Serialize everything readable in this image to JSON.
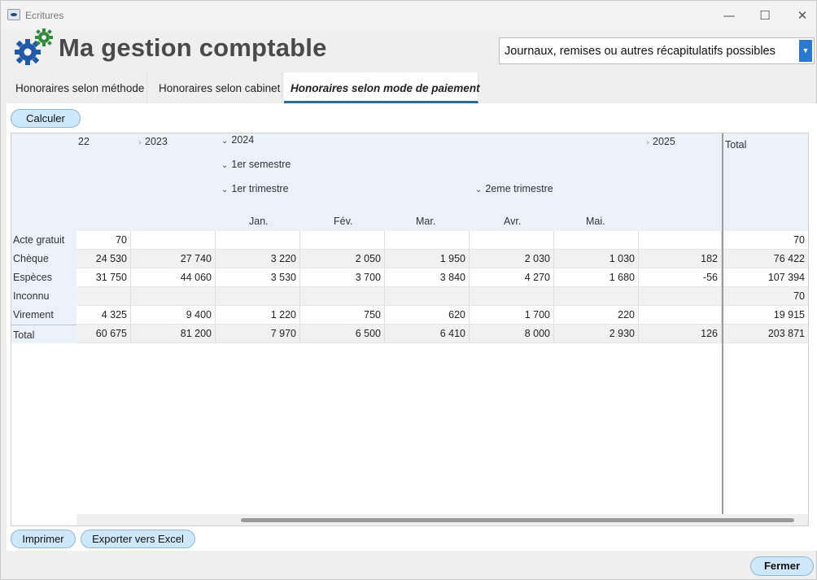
{
  "window": {
    "title": "Ecritures",
    "minimize_glyph": "—",
    "maximize_glyph": "☐",
    "close_glyph": "✕"
  },
  "header": {
    "app_title": "Ma gestion comptable"
  },
  "report_select": {
    "value": "Journaux, remises ou autres récapitulatifs possibles",
    "arrow": "▼"
  },
  "tabs": [
    {
      "label": "Honoraires selon méthode"
    },
    {
      "label": "Honoraires selon cabinet"
    },
    {
      "label": "Honoraires selon mode de paiement",
      "active": true
    }
  ],
  "toolbar": {
    "calculate_label": "Calculer"
  },
  "grid": {
    "years": [
      {
        "label": "22",
        "chevron": ""
      },
      {
        "label": "2023",
        "chevron": "›"
      },
      {
        "label": "2024",
        "chevron": "⌄"
      },
      {
        "label": "2025",
        "chevron": "›"
      }
    ],
    "semester": {
      "label": "1er semestre",
      "chevron": "⌄"
    },
    "quarters": [
      {
        "label": "1er trimestre",
        "chevron": "⌄"
      },
      {
        "label": "2eme trimestre",
        "chevron": "⌄"
      }
    ],
    "months": [
      "Jan.",
      "Fév.",
      "Mar.",
      "Avr.",
      "Mai."
    ],
    "total_header": "Total",
    "rows": [
      {
        "label": "Acte gratuit",
        "cells": [
          "70",
          "",
          "",
          "",
          "",
          "",
          "",
          ""
        ],
        "total": "70"
      },
      {
        "label": "Chèque",
        "cells": [
          "24 530",
          "27 740",
          "3 220",
          "2 050",
          "1 950",
          "2 030",
          "1 030",
          "182"
        ],
        "total": "76 422"
      },
      {
        "label": "Espèces",
        "cells": [
          "31 750",
          "44 060",
          "3 530",
          "3 700",
          "3 840",
          "4 270",
          "1 680",
          "-56"
        ],
        "total": "107 394"
      },
      {
        "label": "Inconnu",
        "cells": [
          "",
          "",
          "",
          "",
          "",
          "",
          "",
          ""
        ],
        "total": "70"
      },
      {
        "label": "Virement",
        "cells": [
          "4 325",
          "9 400",
          "1 220",
          "750",
          "620",
          "1 700",
          "220",
          ""
        ],
        "total": "19 915"
      },
      {
        "label": "Total",
        "cells": [
          "60 675",
          "81 200",
          "7 970",
          "6 500",
          "6 410",
          "8 000",
          "2 930",
          "126"
        ],
        "total": "203 871"
      }
    ]
  },
  "footer": {
    "print_label": "Imprimer",
    "export_label": "Exporter vers Excel",
    "close_label": "Fermer"
  },
  "colors": {
    "accent": "#2a78d0",
    "tab_underline": "#2a6b9c",
    "header_bg": "#eaf1f8",
    "pill_bg": "#cde8fb",
    "logo_blue": "#1f5aa8",
    "logo_green": "#2e8b3a"
  }
}
